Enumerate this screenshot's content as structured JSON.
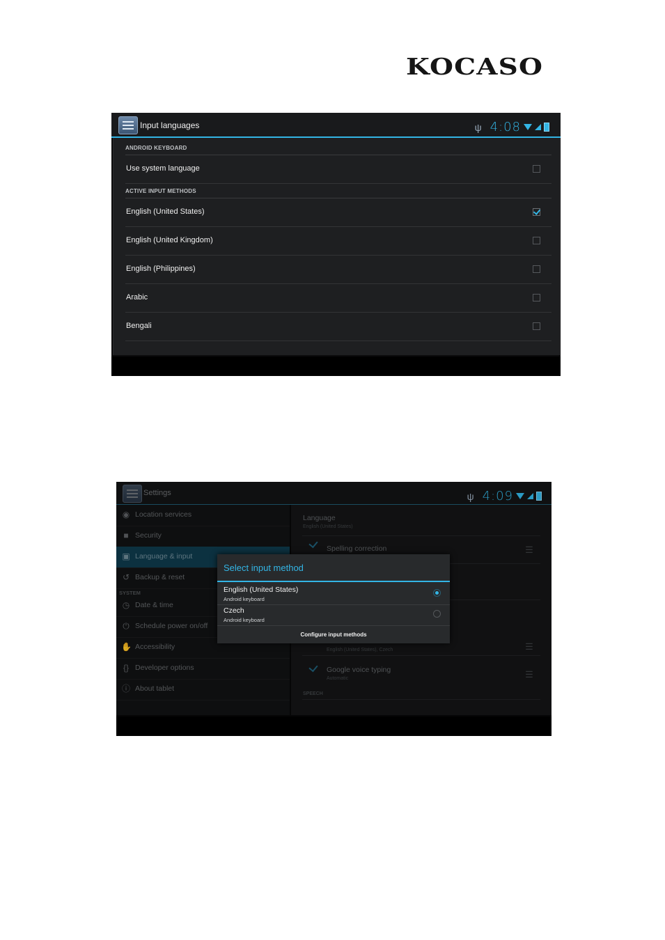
{
  "brand": {
    "logo_text": "KOCASO"
  },
  "screen1": {
    "title": "Input languages",
    "status": {
      "time": "4:08",
      "icons": [
        "usb-icon",
        "wifi-icon",
        "signal-icon",
        "battery-icon"
      ]
    },
    "sections": [
      {
        "header": "ANDROID KEYBOARD",
        "items": [
          {
            "label": "Use system language",
            "checked": false
          }
        ]
      },
      {
        "header": "ACTIVE INPUT METHODS",
        "items": [
          {
            "label": "English (United States)",
            "checked": true
          },
          {
            "label": "English (United Kingdom)",
            "checked": false
          },
          {
            "label": "English (Philippines)",
            "checked": false
          },
          {
            "label": "Arabic",
            "checked": false
          },
          {
            "label": "Bengali",
            "checked": false
          }
        ]
      }
    ]
  },
  "screen2": {
    "title": "Settings",
    "status": {
      "time": "4:09",
      "icons": [
        "usb-icon",
        "wifi-icon",
        "signal-icon",
        "battery-icon"
      ]
    },
    "sidebar": {
      "items": [
        {
          "label": "Location services",
          "icon": "location-icon"
        },
        {
          "label": "Security",
          "icon": "lock-icon"
        },
        {
          "label": "Language & input",
          "icon": "language-icon",
          "active": true
        },
        {
          "label": "Backup & reset",
          "icon": "backup-icon"
        }
      ],
      "system_header": "SYSTEM",
      "system_items": [
        {
          "label": "Date & time",
          "icon": "clock-icon"
        },
        {
          "label": "Schedule power on/off",
          "icon": "power-schedule-icon"
        },
        {
          "label": "Accessibility",
          "icon": "hand-icon"
        },
        {
          "label": "Developer options",
          "icon": "braces-icon"
        },
        {
          "label": "About tablet",
          "icon": "info-icon"
        }
      ]
    },
    "detail": {
      "language_title": "Language",
      "language_value": "English (United States)",
      "spelling": "Spelling correction",
      "keyboard_sub": "English (United States), Czech",
      "voice_title": "Google voice typing",
      "voice_sub": "Automatic",
      "speech_header": "SPEECH"
    },
    "dialog": {
      "title": "Select input method",
      "options": [
        {
          "name": "English (United States)",
          "sub": "Android keyboard",
          "selected": true
        },
        {
          "name": "Czech",
          "sub": "Android keyboard",
          "selected": false
        }
      ],
      "footer": "Configure input methods"
    }
  },
  "colors": {
    "accent": "#33b5e5",
    "panel": "#1e1f21",
    "selected_nav": "#0f3a4c"
  }
}
